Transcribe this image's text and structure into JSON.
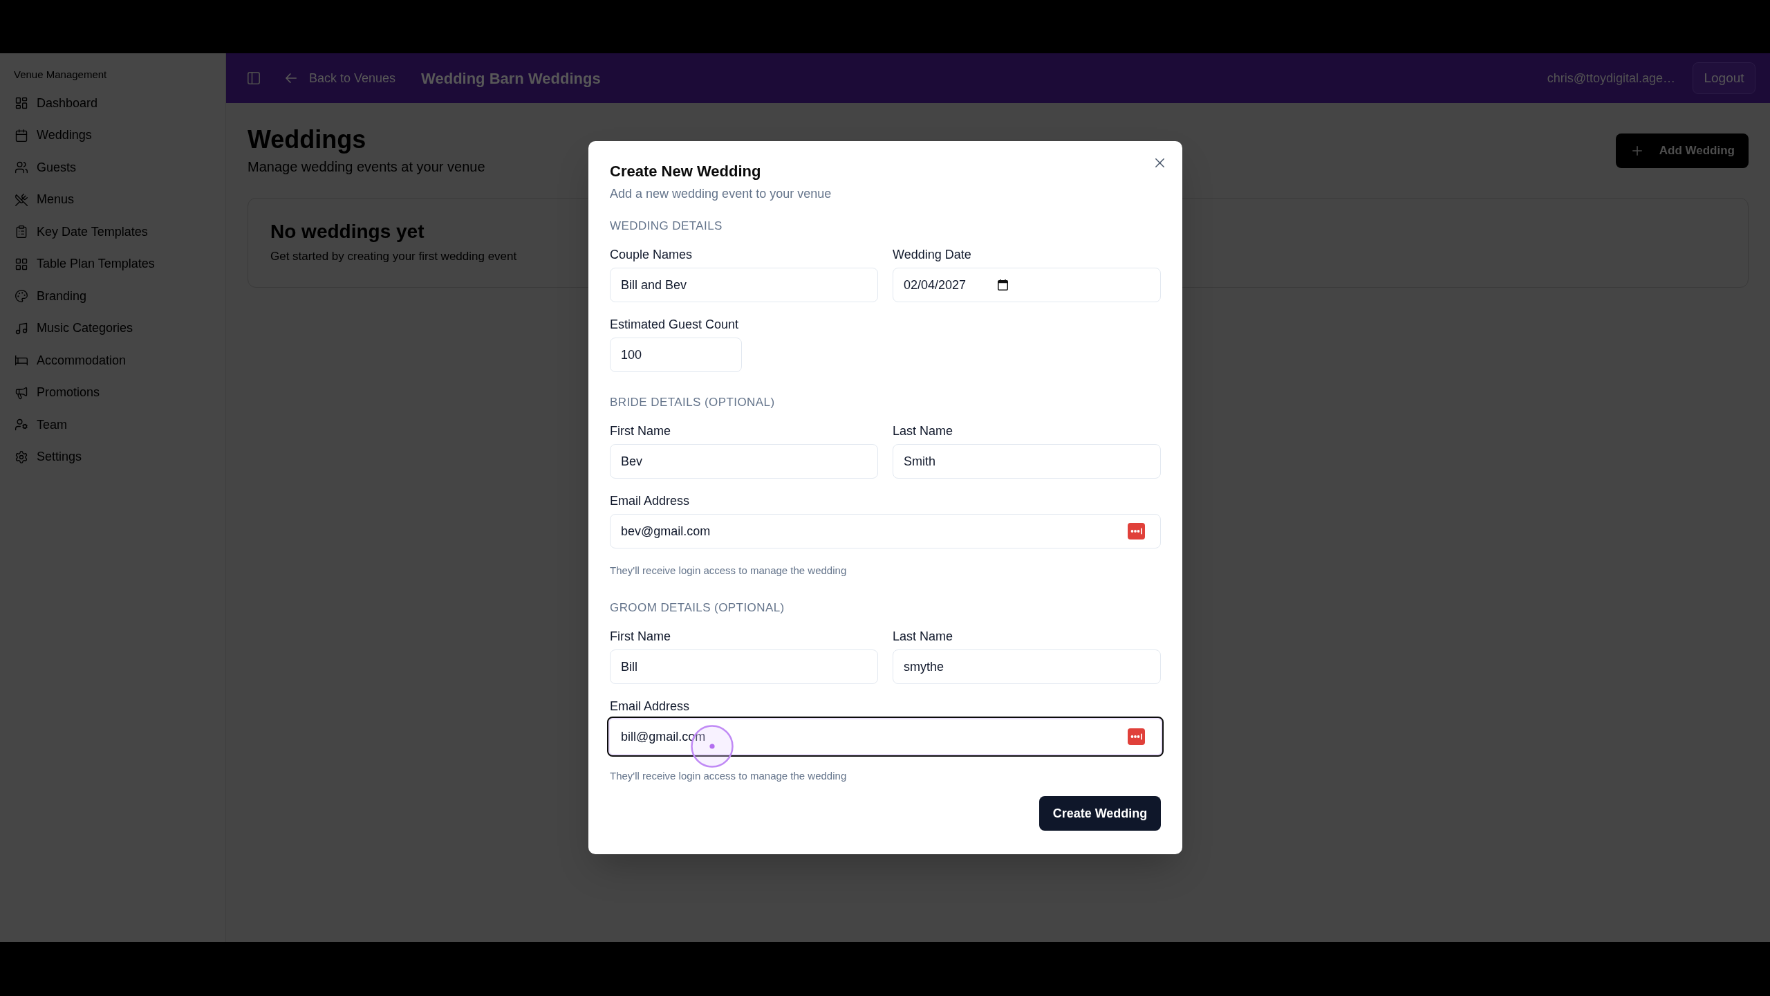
{
  "sidebar": {
    "heading": "Venue Management",
    "items": [
      {
        "label": "Dashboard",
        "selected": false
      },
      {
        "label": "Weddings",
        "selected": false
      },
      {
        "label": "Guests",
        "selected": false
      },
      {
        "label": "Menus",
        "selected": false
      },
      {
        "label": "Key Date Templates",
        "selected": false
      },
      {
        "label": "Table Plan Templates",
        "selected": false
      },
      {
        "label": "Branding",
        "selected": false
      },
      {
        "label": "Music Categories",
        "selected": false
      },
      {
        "label": "Accommodation",
        "selected": false
      },
      {
        "label": "Promotions",
        "selected": false
      },
      {
        "label": "Team",
        "selected": false
      },
      {
        "label": "Settings",
        "selected": false
      }
    ]
  },
  "header": {
    "back_link": "Back to Venues",
    "title": "Wedding Barn Weddings",
    "user_email": "chris@ttoydigital.age…",
    "logout_button": "Logout"
  },
  "page": {
    "title": "Weddings",
    "subtitle": "Manage wedding events at your venue",
    "add_button": "Add Wedding",
    "empty_state": {
      "title": "No weddings yet",
      "text": "Get started by creating your first wedding event"
    }
  },
  "dialog": {
    "title": "Create New Wedding",
    "subtitle": "Add a new wedding event to your venue",
    "sections": [
      {
        "heading": "WEDDING DETAILS",
        "fields": [
          {
            "kind": "text",
            "label": "Couple Names",
            "value": "Bill and Bev",
            "focused": false
          },
          {
            "kind": "date",
            "label": "Wedding Date",
            "value": "02/04/2027",
            "focused": false
          },
          {
            "kind": "number",
            "label": "Estimated Guest Count",
            "value": "100",
            "focused": false
          }
        ]
      },
      {
        "heading": "BRIDE DETAILS (OPTIONAL)",
        "fields": [
          {
            "kind": "text",
            "label": "First Name",
            "value": "Bev",
            "focused": false
          },
          {
            "kind": "text",
            "label": "Last Name",
            "value": "Smith",
            "focused": false
          },
          {
            "kind": "email",
            "label": "Email Address",
            "value": "bev@gmail.com",
            "hint": "They'll receive login access to manage the wedding",
            "focused": false
          }
        ]
      },
      {
        "heading": "GROOM DETAILS (OPTIONAL)",
        "fields": [
          {
            "kind": "text",
            "label": "First Name",
            "value": "Bill",
            "focused": false
          },
          {
            "kind": "text",
            "label": "Last Name",
            "value": "smythe",
            "focused": false
          },
          {
            "kind": "email",
            "label": "Email Address",
            "value": "bill@gmail.com",
            "hint": "They'll receive login access to manage the wedding",
            "focused": true
          }
        ]
      }
    ],
    "submit_button": "Create Wedding"
  }
}
